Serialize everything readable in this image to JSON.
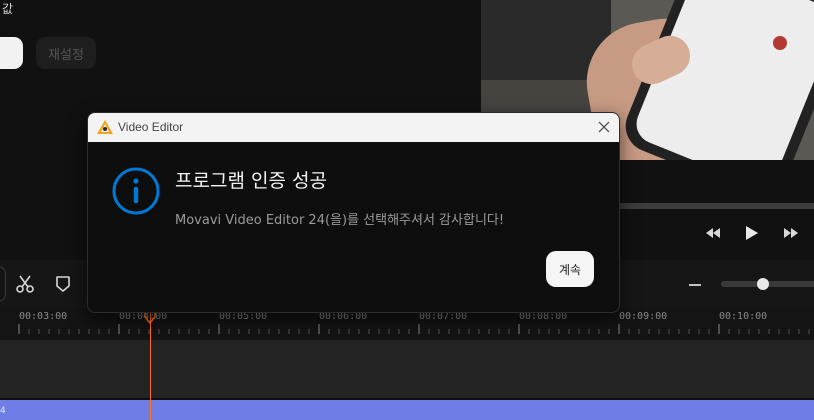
{
  "properties": {
    "top_label": "값",
    "reset_label": "재설정"
  },
  "dialog": {
    "window_title": "Video Editor",
    "heading": "프로그램 인증 성공",
    "message": "Movavi Video Editor 24(을)를 선택해주셔서 감사합니다!",
    "continue_label": "계속",
    "icons": {
      "app": "movavi-logo-icon",
      "close": "close-icon",
      "info": "info-icon"
    },
    "accent_color": "#0078d4"
  },
  "timeline": {
    "ruler_labels": [
      "00:03:00",
      "00:04:00",
      "00:05:00",
      "00:06:00",
      "00:07:00",
      "00:08:00",
      "00:09:00",
      "00:10:00"
    ],
    "audio_track_label": "4",
    "playhead_color": "#ff6d1f",
    "audio_track_color": "#6f7de6",
    "toolbar_icons": [
      "cut-icon",
      "marker-icon",
      "zoom-out-icon"
    ]
  },
  "player": {
    "controls": [
      "rewind-icon",
      "play-icon",
      "fast-forward-icon"
    ]
  }
}
